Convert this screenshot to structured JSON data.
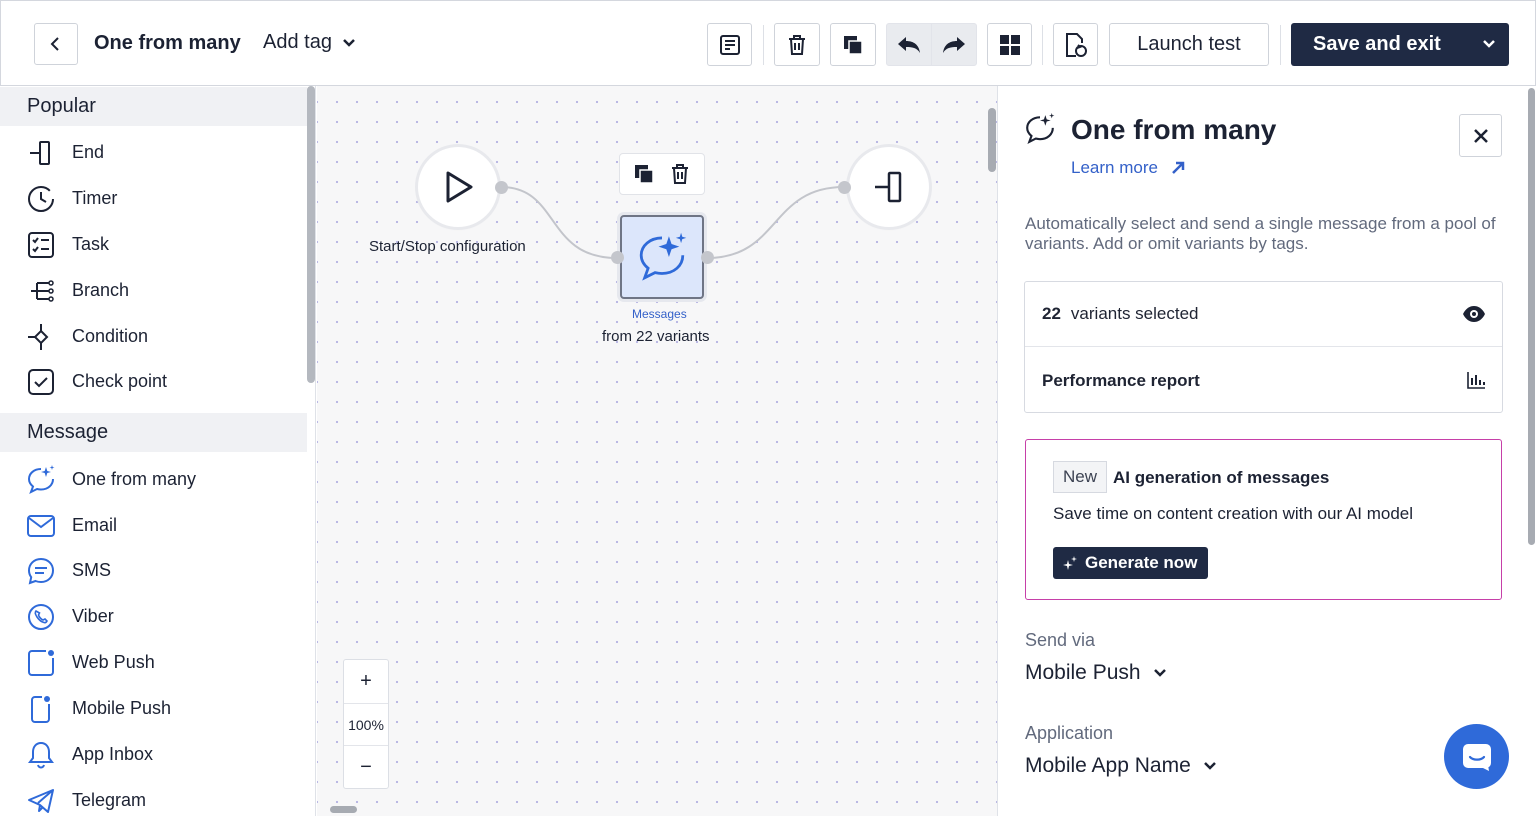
{
  "header": {
    "title": "One from many",
    "add_tag_label": "Add tag",
    "launch_label": "Launch test",
    "save_label": "Save and exit"
  },
  "palette": {
    "popular_heading": "Popular",
    "popular_items": [
      {
        "label": "End",
        "icon": "end-icon"
      },
      {
        "label": "Timer",
        "icon": "timer-icon"
      },
      {
        "label": "Task",
        "icon": "task-icon"
      },
      {
        "label": "Branch",
        "icon": "branch-icon"
      },
      {
        "label": "Condition",
        "icon": "condition-icon"
      },
      {
        "label": "Check point",
        "icon": "checkpoint-icon"
      }
    ],
    "message_heading": "Message",
    "message_items": [
      {
        "label": "One from many",
        "icon": "sparkle-chat-icon"
      },
      {
        "label": "Email",
        "icon": "email-icon"
      },
      {
        "label": "SMS",
        "icon": "sms-icon"
      },
      {
        "label": "Viber",
        "icon": "viber-icon"
      },
      {
        "label": "Web Push",
        "icon": "web-push-icon"
      },
      {
        "label": "Mobile Push",
        "icon": "mobile-push-icon"
      },
      {
        "label": "App Inbox",
        "icon": "bell-icon"
      },
      {
        "label": "Telegram",
        "icon": "telegram-icon"
      }
    ]
  },
  "canvas": {
    "start_label": "Start/Stop configuration",
    "message_node_caption": "Messages",
    "message_node_sub": "from 22 variants",
    "zoom_level": "100%",
    "zoom_in": "+",
    "zoom_out": "−"
  },
  "panel": {
    "title": "One from many",
    "learn_more": "Learn more",
    "description": "Automatically select and send a single message from a pool of variants. Add or omit variants by tags.",
    "variants_count": "22",
    "variants_label": "variants selected",
    "performance_label": "Performance report",
    "ai_badge": "New",
    "ai_title": "AI generation of messages",
    "ai_text": "Save time on content creation with our AI model",
    "ai_button": "Generate now",
    "send_via_label": "Send via",
    "send_via_value": "Mobile Push",
    "application_label": "Application",
    "application_value": "Mobile App Name"
  },
  "colors": {
    "primary_dark": "#1f2a44",
    "link_blue": "#3461c9",
    "icon_blue": "#2f6ad9",
    "ai_border": "#c63fa8",
    "node_fill": "#dce6fb"
  }
}
